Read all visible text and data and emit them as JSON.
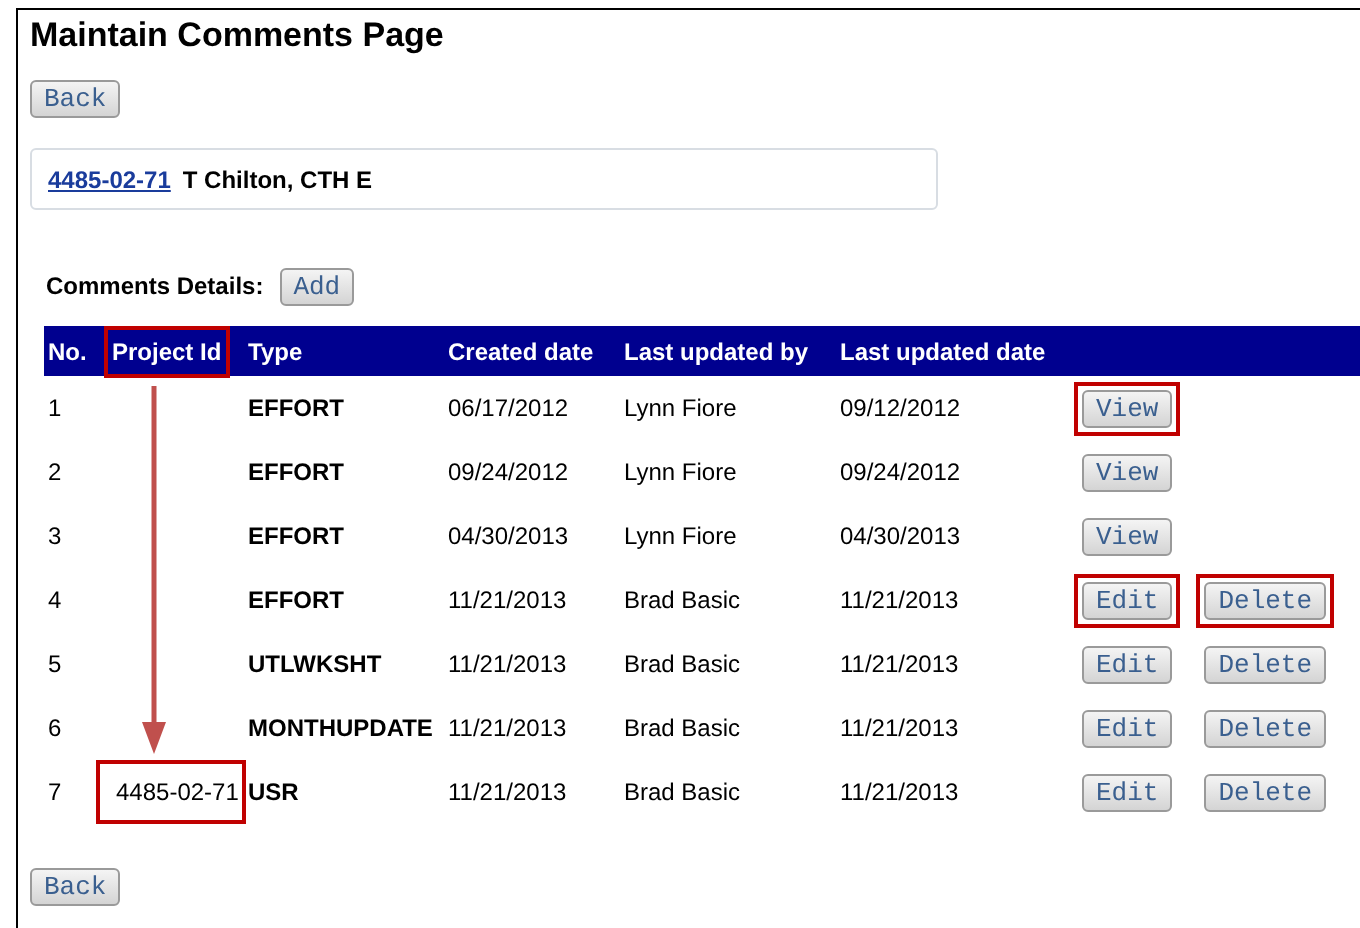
{
  "title": "Maintain Comments Page",
  "back_top": "Back",
  "project": {
    "id": "4485-02-71",
    "name": "T Chilton, CTH E"
  },
  "comments_label": "Comments Details:",
  "add_button": "Add",
  "table": {
    "columns": [
      {
        "label": "No.",
        "highlighted": false
      },
      {
        "label": "Project Id",
        "highlighted": true
      },
      {
        "label": "Type",
        "highlighted": false
      },
      {
        "label": "Created date",
        "highlighted": false
      },
      {
        "label": "Last updated by",
        "highlighted": false
      },
      {
        "label": "Last updated date",
        "highlighted": false
      }
    ],
    "rows": [
      {
        "no": "1",
        "type": "EFFORT",
        "created": "06/17/2012",
        "updated_by": "Lynn Fiore",
        "updated": "09/12/2012",
        "actions": [
          {
            "label": "View",
            "highlighted": true
          }
        ]
      },
      {
        "no": "2",
        "type": "EFFORT",
        "created": "09/24/2012",
        "updated_by": "Lynn Fiore",
        "updated": "09/24/2012",
        "actions": [
          {
            "label": "View",
            "highlighted": false
          }
        ]
      },
      {
        "no": "3",
        "type": "EFFORT",
        "created": "04/30/2013",
        "updated_by": "Lynn Fiore",
        "updated": "04/30/2013",
        "actions": [
          {
            "label": "View",
            "highlighted": false
          }
        ]
      },
      {
        "no": "4",
        "type": "EFFORT",
        "created": "11/21/2013",
        "updated_by": "Brad Basic",
        "updated": "11/21/2013",
        "actions": [
          {
            "label": "Edit",
            "highlighted": true
          },
          {
            "label": "Delete",
            "highlighted": true
          }
        ]
      },
      {
        "no": "5",
        "type": "UTLWKSHT",
        "created": "11/21/2013",
        "updated_by": "Brad Basic",
        "updated": "11/21/2013",
        "actions": [
          {
            "label": "Edit",
            "highlighted": false
          },
          {
            "label": "Delete",
            "highlighted": false
          }
        ]
      },
      {
        "no": "6",
        "type": "MONTHUPDATE",
        "created": "11/21/2013",
        "updated_by": "Brad Basic",
        "updated": "11/21/2013",
        "actions": [
          {
            "label": "Edit",
            "highlighted": false
          },
          {
            "label": "Delete",
            "highlighted": false
          }
        ]
      },
      {
        "no": "7",
        "project_id": "4485-02-71",
        "project_id_highlighted": true,
        "type": "USR",
        "created": "11/21/2013",
        "updated_by": "Brad Basic",
        "updated": "11/21/2013",
        "actions": [
          {
            "label": "Edit",
            "highlighted": false
          },
          {
            "label": "Delete",
            "highlighted": false
          }
        ]
      }
    ]
  },
  "annotation_arrow": true,
  "back_bottom": "Back"
}
